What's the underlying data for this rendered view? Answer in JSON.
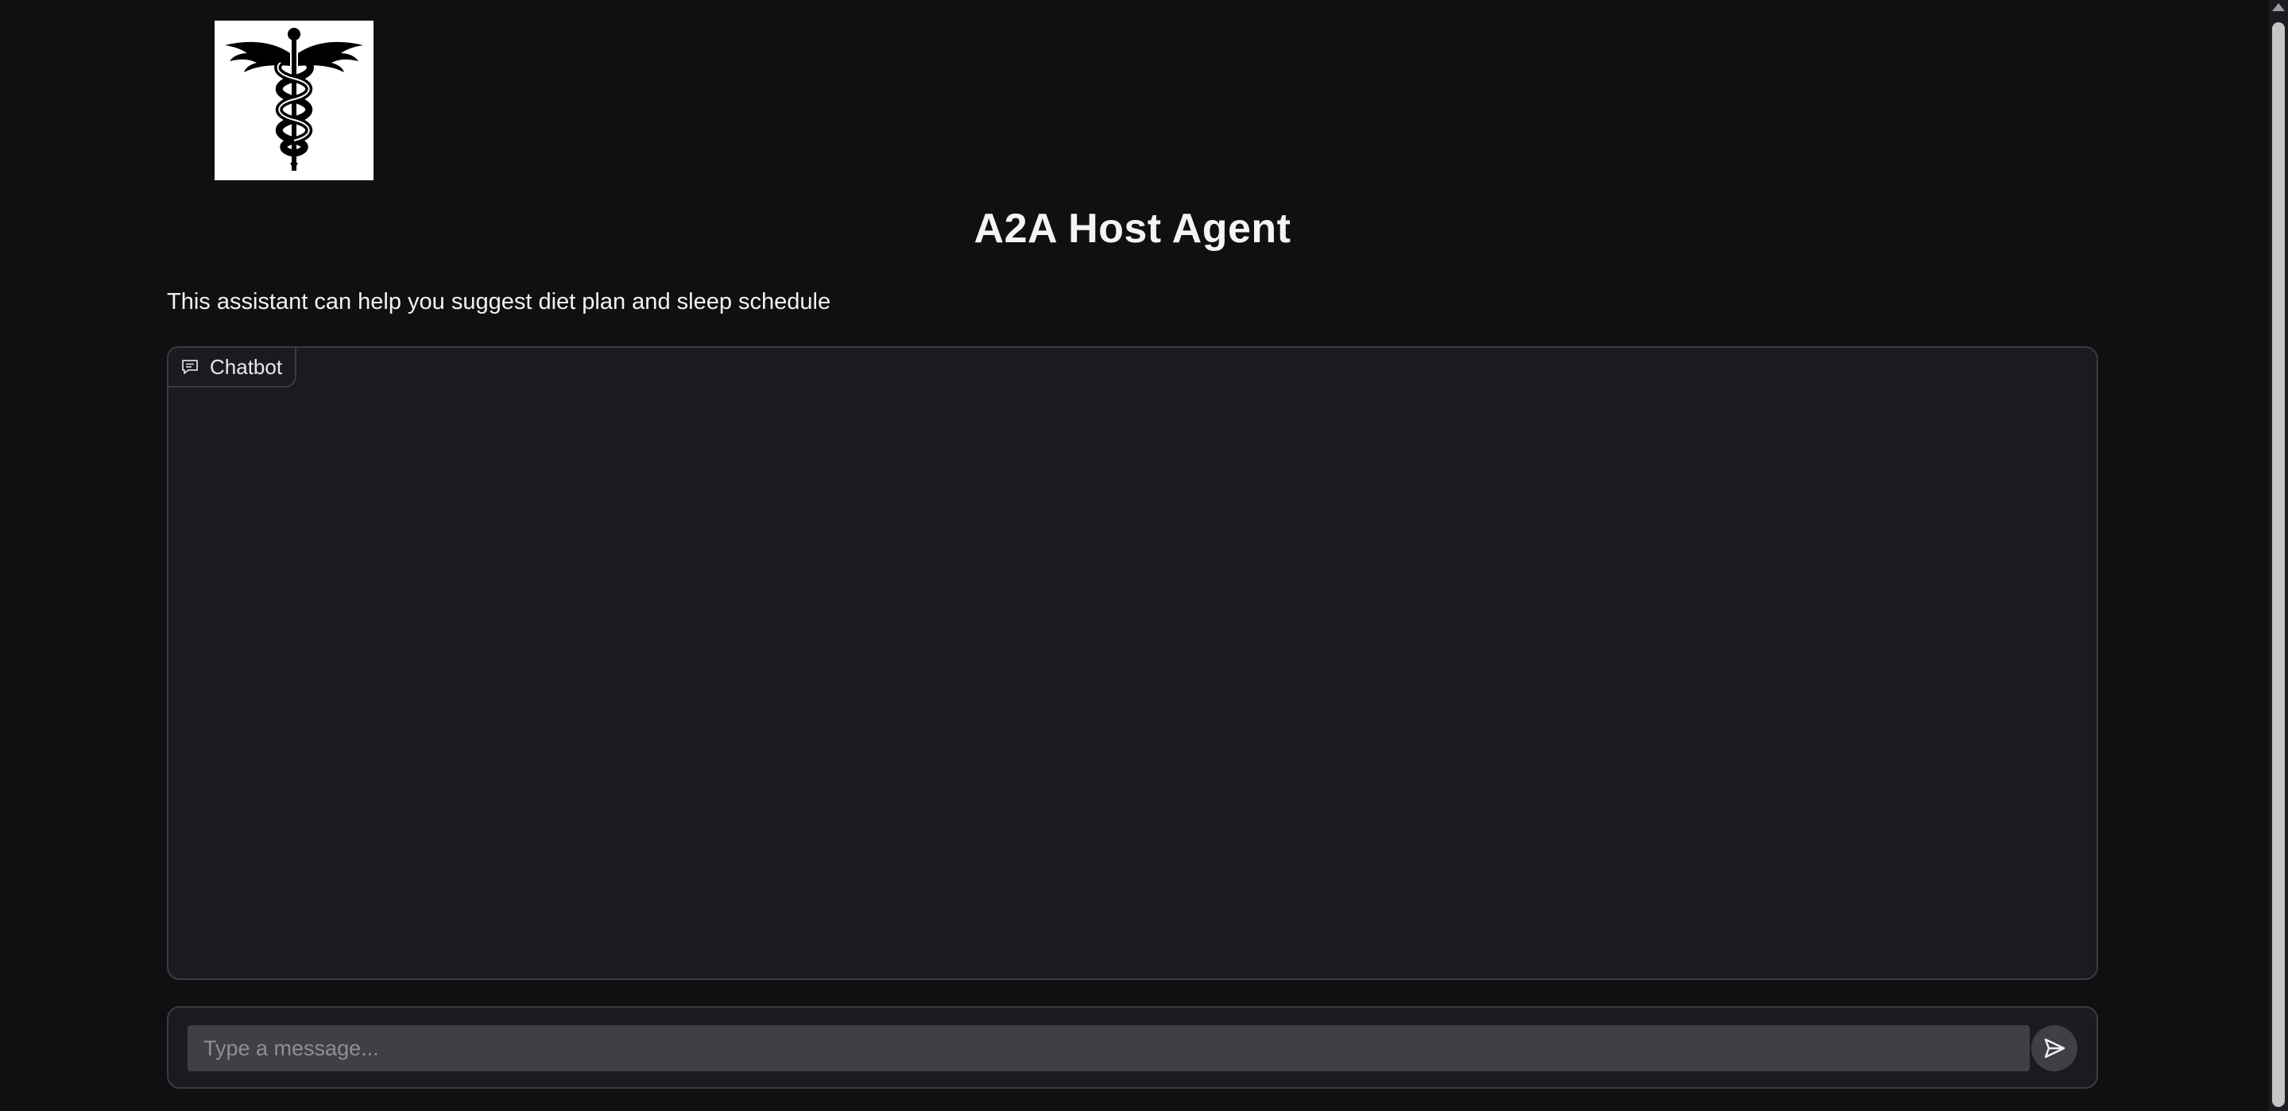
{
  "header": {
    "logo": "caduceus-logo",
    "title": "A2A Host Agent",
    "description": "This assistant can help you suggest diet plan and sleep schedule"
  },
  "chatbot": {
    "label": "Chatbot",
    "icon": "chat-bubble-icon"
  },
  "composer": {
    "placeholder": "Type a message...",
    "value": "",
    "send_icon": "send-icon"
  },
  "colors": {
    "background": "#0f1012",
    "panel": "#1a1b1e",
    "border": "#3a3b3f",
    "input": "#3f3f46",
    "text": "#f2f2f2"
  }
}
